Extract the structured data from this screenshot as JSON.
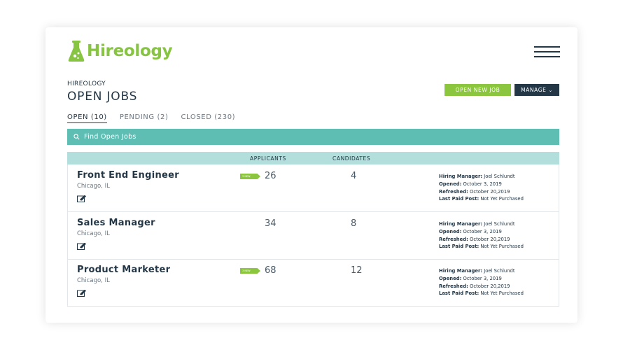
{
  "brand": {
    "name": "Hireology",
    "accent": "#8cc63f",
    "dark": "#243746",
    "teal": "#5ebeb4"
  },
  "header": {
    "eyebrow": "HIREOLOGY",
    "title": "OPEN JOBS"
  },
  "actions": {
    "open_new_job": "OPEN NEW JOB",
    "manage": "MANAGE"
  },
  "tabs": [
    {
      "label": "OPEN (10)",
      "active": true
    },
    {
      "label": "PENDING (2)",
      "active": false
    },
    {
      "label": "CLOSED (230)",
      "active": false
    }
  ],
  "search": {
    "placeholder": "Find Open Jobs"
  },
  "table": {
    "columns": {
      "applicants": "APPLICANTS",
      "candidates": "CANDIDATES"
    },
    "meta_labels": {
      "hiring_manager": "Hiring Manager:",
      "opened": "Opened:",
      "refreshed": "Refreshed:",
      "last_paid_post": "Last Paid Post:"
    },
    "rows": [
      {
        "title": "Front End Engineer",
        "location": "Chicago, IL",
        "new_badge": "3 NEW",
        "applicants": "26",
        "candidates": "4",
        "hiring_manager": "Joel Schlundt",
        "opened": "October 3, 2019",
        "refreshed": "October 20,2019",
        "last_paid_post": "Not Yet Purchased"
      },
      {
        "title": "Sales Manager",
        "location": "Chicago, IL",
        "new_badge": "",
        "applicants": "34",
        "candidates": "8",
        "hiring_manager": "Joel Schlundt",
        "opened": "October 3, 2019",
        "refreshed": "October 20,2019",
        "last_paid_post": "Not Yet Purchased"
      },
      {
        "title": "Product Marketer",
        "location": "Chicago, IL",
        "new_badge": "3 NEW",
        "applicants": "68",
        "candidates": "12",
        "hiring_manager": "Joel Schlundt",
        "opened": "October 3, 2019",
        "refreshed": "October 20,2019",
        "last_paid_post": "Not Yet Purchased"
      }
    ]
  }
}
